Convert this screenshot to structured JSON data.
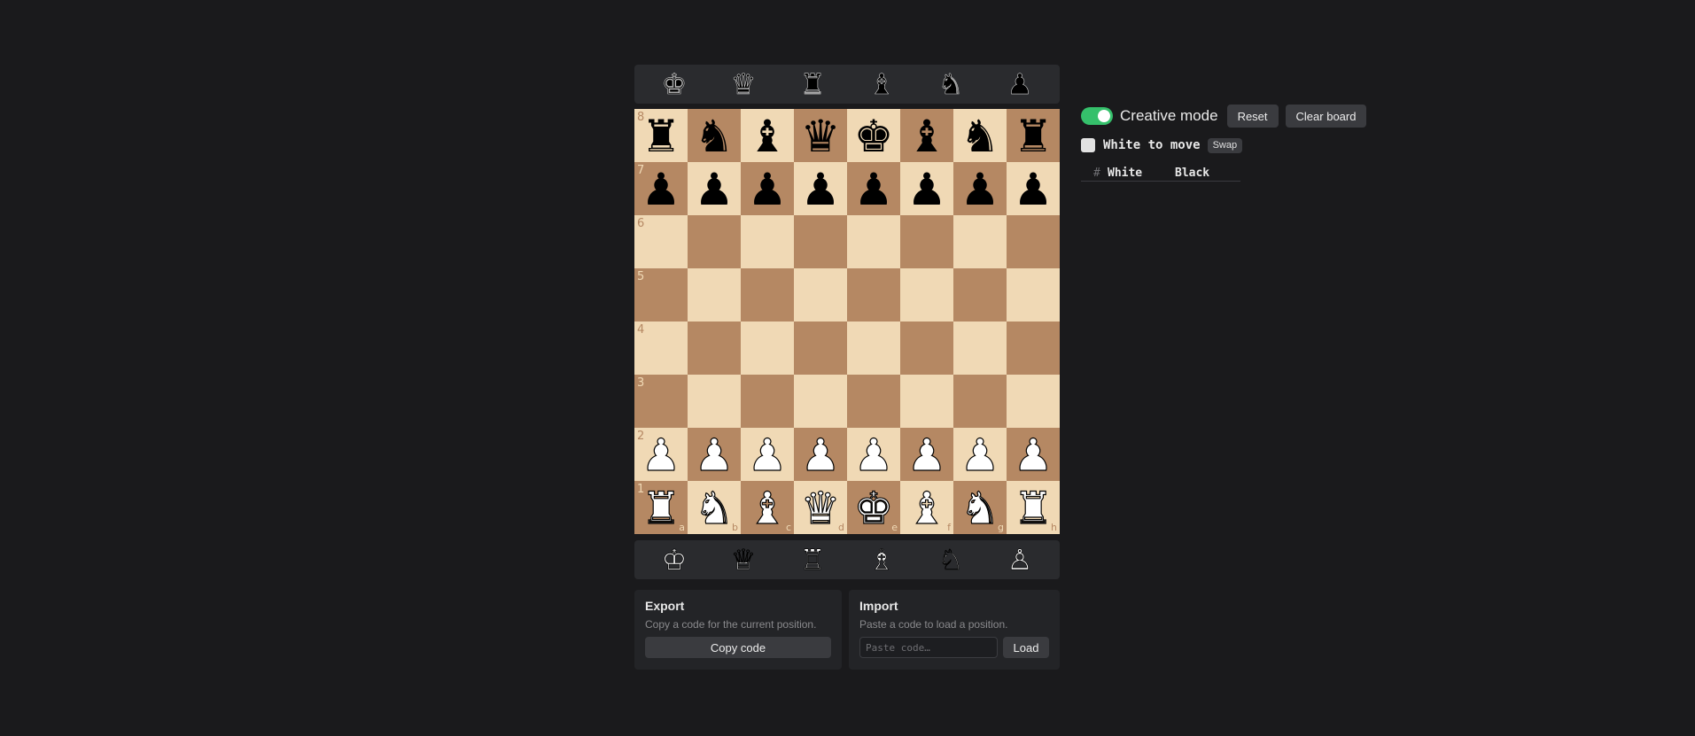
{
  "tray_top": [
    {
      "glyph": "♚",
      "name": "king"
    },
    {
      "glyph": "♛",
      "name": "queen"
    },
    {
      "glyph": "♜",
      "name": "rook"
    },
    {
      "glyph": "♝",
      "name": "bishop"
    },
    {
      "glyph": "♞",
      "name": "knight"
    },
    {
      "glyph": "♟",
      "name": "pawn"
    }
  ],
  "tray_bottom": [
    {
      "glyph": "♔",
      "name": "king"
    },
    {
      "glyph": "♕",
      "name": "queen"
    },
    {
      "glyph": "♖",
      "name": "rook"
    },
    {
      "glyph": "♗",
      "name": "bishop"
    },
    {
      "glyph": "♘",
      "name": "knight"
    },
    {
      "glyph": "♙",
      "name": "pawn"
    }
  ],
  "board": {
    "files": [
      "a",
      "b",
      "c",
      "d",
      "e",
      "f",
      "g",
      "h"
    ],
    "ranks": [
      "8",
      "7",
      "6",
      "5",
      "4",
      "3",
      "2",
      "1"
    ],
    "position": [
      [
        "r",
        "n",
        "b",
        "q",
        "k",
        "b",
        "n",
        "r"
      ],
      [
        "p",
        "p",
        "p",
        "p",
        "p",
        "p",
        "p",
        "p"
      ],
      [
        "",
        "",
        "",
        "",
        "",
        "",
        "",
        ""
      ],
      [
        "",
        "",
        "",
        "",
        "",
        "",
        "",
        ""
      ],
      [
        "",
        "",
        "",
        "",
        "",
        "",
        "",
        ""
      ],
      [
        "",
        "",
        "",
        "",
        "",
        "",
        "",
        ""
      ],
      [
        "P",
        "P",
        "P",
        "P",
        "P",
        "P",
        "P",
        "P"
      ],
      [
        "R",
        "N",
        "B",
        "Q",
        "K",
        "B",
        "N",
        "R"
      ]
    ],
    "glyphs": {
      "K": "♚",
      "Q": "♛",
      "R": "♜",
      "B": "♝",
      "N": "♞",
      "P": "♟",
      "k": "♚",
      "q": "♛",
      "r": "♜",
      "b": "♝",
      "n": "♞",
      "p": "♟"
    },
    "names": {
      "k": "king",
      "q": "queen",
      "r": "rook",
      "b": "bishop",
      "n": "knight",
      "p": "pawn"
    },
    "light_color": "#f0d9b5",
    "dark_color": "#b58863"
  },
  "controls": {
    "creative_mode_label": "Creative mode",
    "creative_mode_on": true,
    "reset_label": "Reset",
    "clear_label": "Clear board",
    "turn_label": "White to move",
    "swap_label": "Swap"
  },
  "moves": {
    "num_header": "#",
    "white_header": "White",
    "black_header": "Black"
  },
  "export": {
    "title": "Export",
    "description": "Copy a code for the current position.",
    "button": "Copy code"
  },
  "import": {
    "title": "Import",
    "description": "Paste a code to load a position.",
    "placeholder": "Paste code…",
    "button": "Load"
  },
  "colors": {
    "accent_toggle": "#35c06b",
    "background": "#1a1a1c"
  }
}
